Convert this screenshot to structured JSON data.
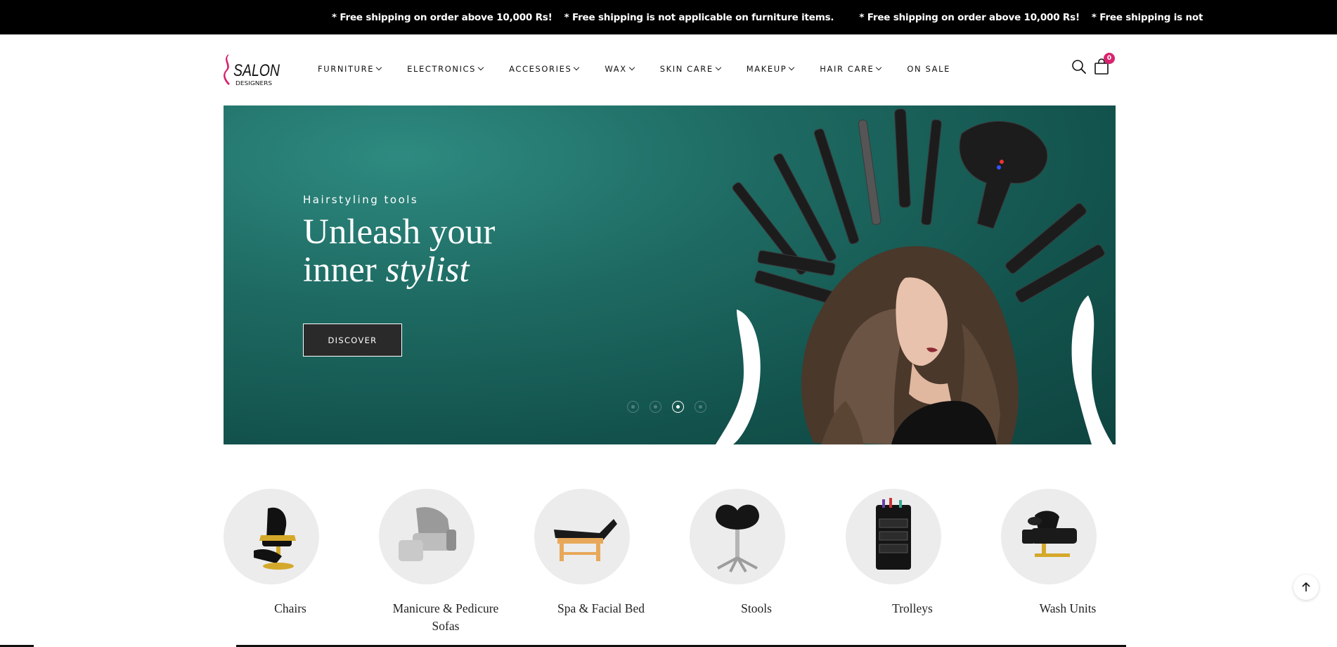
{
  "announcement": {
    "messages": [
      "* Free shipping on order above 10,000 Rs!",
      "* Free shipping is not applicable on furniture items.",
      "* Free shipping on order above 10,000 Rs!",
      "* Free shipping is not"
    ]
  },
  "header": {
    "logo_alt": "Salon Designers",
    "logo_top": "SALON",
    "logo_bottom": "DESIGNERS",
    "nav": [
      {
        "label": "FURNITURE",
        "dropdown": true
      },
      {
        "label": "ELECTRONICS",
        "dropdown": true
      },
      {
        "label": "ACCESORIES",
        "dropdown": true
      },
      {
        "label": "WAX",
        "dropdown": true
      },
      {
        "label": "SKIN CARE",
        "dropdown": true
      },
      {
        "label": "MAKEUP",
        "dropdown": true
      },
      {
        "label": "HAIR CARE",
        "dropdown": true
      },
      {
        "label": "ON SALE",
        "dropdown": false
      }
    ],
    "cart_count": "0",
    "icons": {
      "search": "search-icon",
      "cart": "shopping-bag-icon"
    }
  },
  "hero": {
    "eyebrow": "Hairstyling tools",
    "title_line1": "Unleash your",
    "title_line2_plain": "inner ",
    "title_line2_italic": "stylist",
    "button": "DISCOVER",
    "slides": 4,
    "active_slide": 3
  },
  "categories": [
    {
      "label": "Chairs",
      "icon": "barber-chair-icon"
    },
    {
      "label": "Manicure & Pedicure Sofas",
      "icon": "pedicure-sofa-icon"
    },
    {
      "label": "Spa & Facial Bed",
      "icon": "facial-bed-icon"
    },
    {
      "label": "Stools",
      "icon": "saddle-stool-icon"
    },
    {
      "label": "Trolleys",
      "icon": "trolley-icon"
    },
    {
      "label": "Wash Units",
      "icon": "wash-unit-icon"
    }
  ],
  "colors": {
    "accent": "#d6246e",
    "hero_bg": "#1e6b63",
    "announce_bg": "#000000"
  }
}
